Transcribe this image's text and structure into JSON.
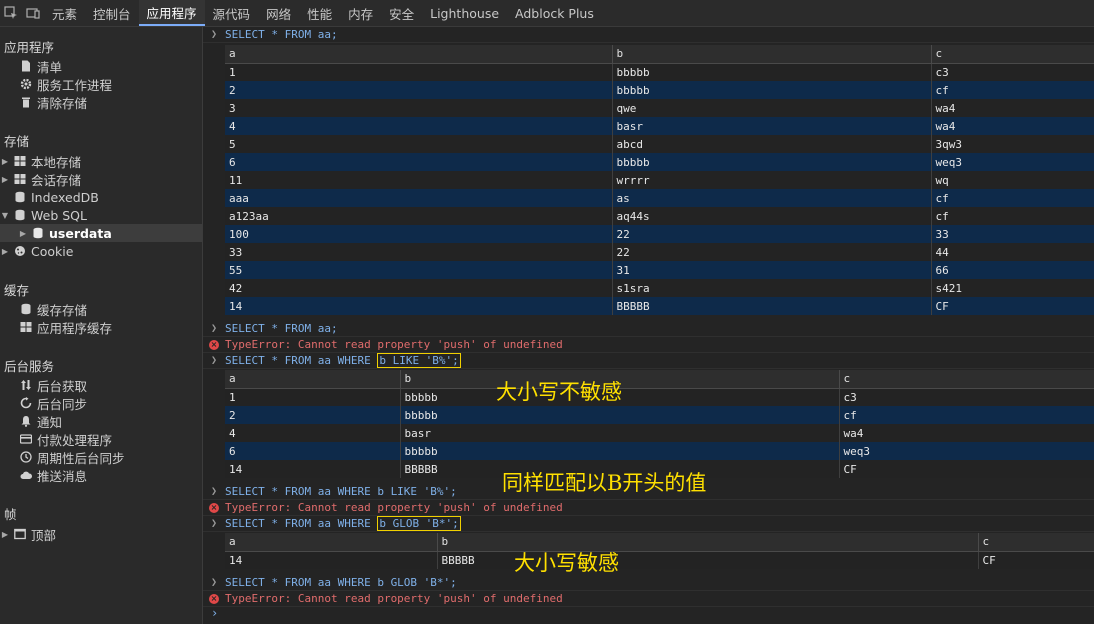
{
  "tabs": [
    "元素",
    "控制台",
    "应用程序",
    "源代码",
    "网络",
    "性能",
    "内存",
    "安全",
    "Lighthouse",
    "Adblock Plus"
  ],
  "active_tab": "应用程序",
  "sidebar": {
    "app_title": "应用程序",
    "app_items": [
      "清单",
      "服务工作进程",
      "清除存储"
    ],
    "storage_title": "存储",
    "storage_items": [
      "本地存储",
      "会话存储",
      "IndexedDB",
      "Web SQL",
      "userdata",
      "Cookie"
    ],
    "cache_title": "缓存",
    "cache_items": [
      "缓存存储",
      "应用程序缓存"
    ],
    "bg_title": "后台服务",
    "bg_items": [
      "后台获取",
      "后台同步",
      "通知",
      "付款处理程序",
      "周期性后台同步",
      "推送消息"
    ],
    "frames_title": "帧",
    "frames_items": [
      "顶部"
    ]
  },
  "console": {
    "q1": "SELECT * FROM aa;",
    "table1": {
      "headers": [
        "a",
        "b",
        "c"
      ],
      "rows": [
        [
          "1",
          "bbbbb",
          "c3"
        ],
        [
          "2",
          "bbbbb",
          "cf"
        ],
        [
          "3",
          "qwe",
          "wa4"
        ],
        [
          "4",
          "basr",
          "wa4"
        ],
        [
          "5",
          "abcd",
          "3qw3"
        ],
        [
          "6",
          "bbbbb",
          "weq3"
        ],
        [
          "11",
          "wrrrr",
          "wq"
        ],
        [
          "aaa",
          "as",
          "cf"
        ],
        [
          "a123aa",
          "aq44s",
          "cf"
        ],
        [
          "100",
          "22",
          "33"
        ],
        [
          "33",
          "22",
          "44"
        ],
        [
          "55",
          "31",
          "66"
        ],
        [
          "42",
          "s1sra",
          "s421"
        ],
        [
          "14",
          "BBBBB",
          "CF"
        ]
      ]
    },
    "q2": "SELECT * FROM aa;",
    "err1": "TypeError: Cannot read property 'push' of undefined",
    "q3_prefix": "SELECT * FROM aa WHERE ",
    "q3_hl": "b LIKE 'B%';",
    "table2": {
      "headers": [
        "a",
        "b",
        "c"
      ],
      "rows": [
        [
          "1",
          "bbbbb",
          "c3"
        ],
        [
          "2",
          "bbbbb",
          "cf"
        ],
        [
          "4",
          "basr",
          "wa4"
        ],
        [
          "6",
          "bbbbb",
          "weq3"
        ],
        [
          "14",
          "BBBBB",
          "CF"
        ]
      ]
    },
    "q4": "SELECT * FROM aa WHERE b LIKE 'B%';",
    "err2": "TypeError: Cannot read property 'push' of undefined",
    "q5_prefix": "SELECT * FROM aa WHERE ",
    "q5_hl": "b GLOB 'B*';",
    "table3": {
      "headers": [
        "a",
        "b",
        "c"
      ],
      "rows": [
        [
          "14",
          "BBBBB",
          "CF"
        ]
      ]
    },
    "q6": "SELECT * FROM aa WHERE b GLOB 'B*';",
    "err3": "TypeError: Cannot read property 'push' of undefined",
    "prompt": "›"
  },
  "annotations": {
    "a1": "大小写不敏感",
    "a2": "同样匹配以B开头的值",
    "a3": "大小写敏感"
  },
  "colors": {
    "accent": "#7cacf8",
    "command": "#7fb0e8",
    "error": "#e06c6c",
    "row_highlight": "#0e2a4a",
    "annotation": "#ffe000",
    "highlight_box": "#f0d000"
  }
}
